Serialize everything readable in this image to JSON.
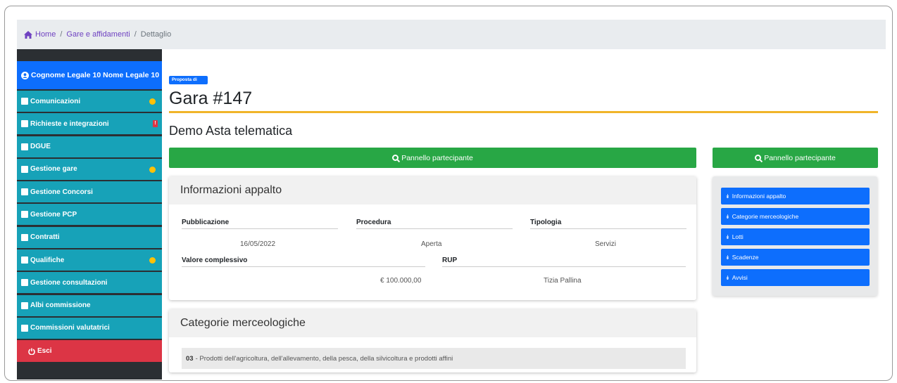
{
  "breadcrumb": {
    "home": "Home",
    "section": "Gare e affidamenti",
    "current": "Dettaglio",
    "separator": "/"
  },
  "sidebar": {
    "user_name": "Cognome Legale 10 Nome Legale 10",
    "items": [
      {
        "label": "Comunicazioni",
        "icon": "envelope-icon",
        "indicator": "dot"
      },
      {
        "label": "Richieste e integrazioni",
        "icon": "paper-plane-icon",
        "indicator": "badge",
        "badge_text": "!"
      },
      {
        "label": "DGUE",
        "icon": "edit-icon",
        "indicator": ""
      },
      {
        "label": "Gestione gare",
        "icon": "calendar-icon",
        "indicator": "dot"
      },
      {
        "label": "Gestione Concorsi",
        "icon": "chair-icon",
        "indicator": ""
      },
      {
        "label": "Gestione PCP",
        "icon": "flask-icon",
        "indicator": ""
      },
      {
        "label": "Contratti",
        "icon": "check-square-icon",
        "indicator": ""
      },
      {
        "label": "Qualifiche",
        "icon": "folder-icon",
        "indicator": "dot"
      },
      {
        "label": "Gestione consultazioni",
        "icon": "megaphone-icon",
        "indicator": ""
      },
      {
        "label": "Albi commissione",
        "icon": "folder-icon",
        "indicator": ""
      },
      {
        "label": "Commissioni valutatrici",
        "icon": "glasses-icon",
        "indicator": ""
      }
    ],
    "logout_label": "Esci"
  },
  "main": {
    "status": "Proposta di aggiudicazione",
    "title": "Gara #147",
    "subtitle": "Demo Asta telematica",
    "participant_panel_label": "Pannello partecipante"
  },
  "info_card": {
    "header": "Informazioni appalto",
    "fields": {
      "pubblicazione_label": "Pubblicazione",
      "pubblicazione_value": "16/05/2022",
      "procedura_label": "Procedura",
      "procedura_value": "Aperta",
      "tipologia_label": "Tipologia",
      "tipologia_value": "Servizi",
      "valore_label": "Valore complessivo",
      "valore_value": "€ 100.000,00",
      "rup_label": "RUP",
      "rup_value": "Tizia Pallina"
    }
  },
  "categories_card": {
    "header": "Categorie merceologiche",
    "rows": [
      {
        "code": "03",
        "text": "- Prodotti dell'agricoltura, dell'allevamento, della pesca, della silvicoltura e prodotti affini"
      }
    ]
  },
  "side_nav": {
    "items": [
      {
        "label": "Informazioni appalto"
      },
      {
        "label": "Categorie merceologiche"
      },
      {
        "label": "Lotti"
      },
      {
        "label": "Scadenze"
      },
      {
        "label": "Avvisi"
      }
    ]
  },
  "colors": {
    "sidebar_item": "#17a2b8",
    "user_box": "#0d6efd",
    "logout": "#dc3545",
    "action_button": "#28a745",
    "title_rule": "#f0b429",
    "indicator_dot": "#ffc107"
  }
}
